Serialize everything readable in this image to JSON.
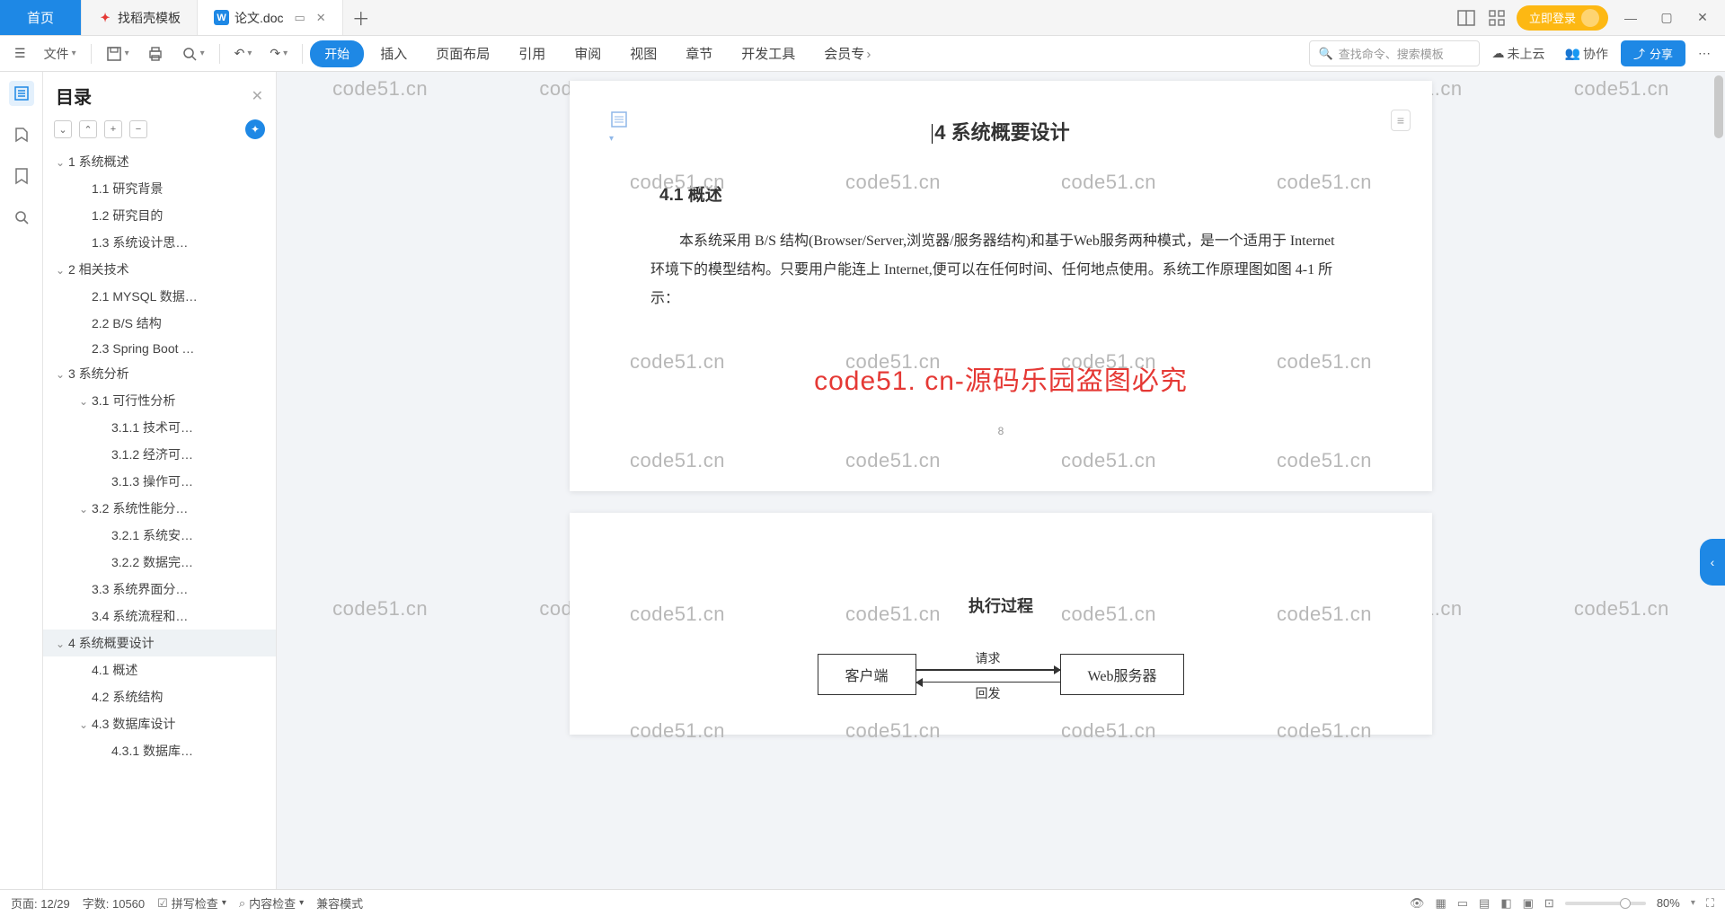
{
  "tabs": {
    "home": "首页",
    "t1": "找稻壳模板",
    "t2": "论文.doc"
  },
  "login": "立即登录",
  "ribbon": {
    "file": "文件",
    "start": "开始",
    "menus": [
      "插入",
      "页面布局",
      "引用",
      "审阅",
      "视图",
      "章节",
      "开发工具"
    ],
    "member": "会员专",
    "search_ph": "查找命令、搜索模板",
    "cloud": "未上云",
    "coop": "协作",
    "share": "分享"
  },
  "sidebar": {
    "title": "目录",
    "toc": [
      {
        "t": "1 系统概述",
        "lv": 1,
        "c": 1
      },
      {
        "t": "1.1 研究背景",
        "lv": 2
      },
      {
        "t": "1.2 研究目的",
        "lv": 2
      },
      {
        "t": "1.3 系统设计思…",
        "lv": 2
      },
      {
        "t": "2 相关技术",
        "lv": 1,
        "c": 1
      },
      {
        "t": "2.1 MYSQL 数据…",
        "lv": 2
      },
      {
        "t": "2.2 B/S 结构",
        "lv": 2
      },
      {
        "t": "2.3 Spring Boot …",
        "lv": 2
      },
      {
        "t": "3 系统分析",
        "lv": 1,
        "c": 1
      },
      {
        "t": "3.1 可行性分析",
        "lv": 2,
        "c": 1
      },
      {
        "t": "3.1.1 技术可…",
        "lv": 3
      },
      {
        "t": "3.1.2 经济可…",
        "lv": 3
      },
      {
        "t": "3.1.3 操作可…",
        "lv": 3
      },
      {
        "t": "3.2 系统性能分…",
        "lv": 2,
        "c": 1
      },
      {
        "t": "3.2.1 系统安…",
        "lv": 3
      },
      {
        "t": "3.2.2 数据完…",
        "lv": 3
      },
      {
        "t": "3.3 系统界面分…",
        "lv": 2
      },
      {
        "t": "3.4 系统流程和…",
        "lv": 2
      },
      {
        "t": "4 系统概要设计",
        "lv": 1,
        "c": 1,
        "sel": 1
      },
      {
        "t": "4.1 概述",
        "lv": 2
      },
      {
        "t": "4.2 系统结构",
        "lv": 2
      },
      {
        "t": "4.3 数据库设计",
        "lv": 2,
        "c": 1
      },
      {
        "t": "4.3.1 数据库…",
        "lv": 3
      }
    ]
  },
  "doc": {
    "h1": "系统概要设计",
    "h1_prefix": "4",
    "h2": "4.1 概述",
    "para": "本系统采用 B/S 结构(Browser/Server,浏览器/服务器结构)和基于Web服务两种模式，是一个适用于 Internet 环境下的模型结构。只要用户能连上 Internet,便可以在任何时间、任何地点使用。系统工作原理图如图 4-1 所示：",
    "wm": "code51.cn",
    "wm_red": "code51. cn-源码乐园盗图必究",
    "pgnum": "8",
    "p2_title": "执行过程",
    "box_l": "客户端",
    "box_r": "Web服务器",
    "arr_t": "请求",
    "arr_b": "回发"
  },
  "status": {
    "page": "页面: 12/29",
    "words": "字数: 10560",
    "spell": "拼写检查",
    "content": "内容检查",
    "compat": "兼容模式",
    "zoom": "80%"
  }
}
